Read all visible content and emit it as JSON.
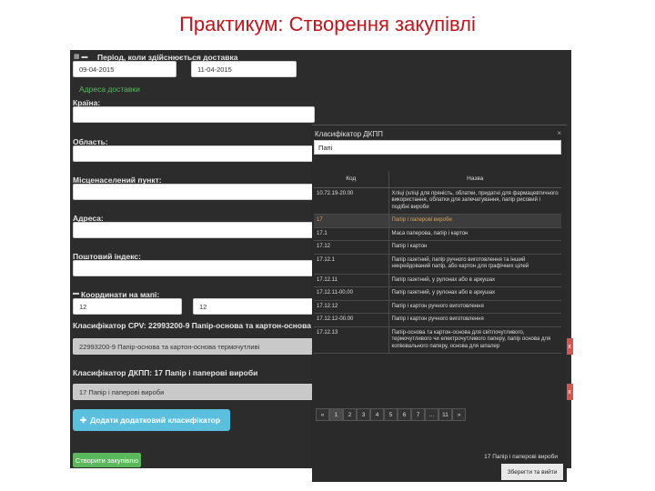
{
  "slide": {
    "title": "Практикум: Створення закупівлі"
  },
  "form": {
    "period_label": "Період, коли здійснюється доставка",
    "date_from": "09-04-2015",
    "date_to": "11-04-2015",
    "address_link": "Адреса доставки",
    "country_label": "Країна:",
    "region_label": "Область:",
    "city_label": "Місценаселений пункт:",
    "address_label": "Адреса:",
    "postcode_label": "Поштовий індекс:",
    "coords_label": "Координати на мапі:",
    "lat": "12",
    "lng": "12",
    "cpv_label": "Класифікатор CPV: 22993200-9 Папір-основа та картон-основа термочутливі",
    "cpv_value": "22993200-9 Папір-основа та картон-основа термочутливі",
    "dkpp_label": "Класифікатор ДКПП: 17 Папір і паперові вироби",
    "dkpp_value": "17 Папір і паперові вироби",
    "add_classifier": "Додати додатковий класифікатор",
    "create_button": "Створити закупівлю",
    "remove_icon": "x"
  },
  "modal": {
    "title": "Класифікатор ДКПП",
    "close": "×",
    "search": "Папі",
    "columns": [
      "Код",
      "Назва"
    ],
    "rows": [
      {
        "code": "10.72.19-20.00",
        "name": "Хліці (хліці для пряність, облатки, придатні для фармацевтичного використання, облатки для запечатування, папір рисовий і подібні вироби"
      },
      {
        "code": "17",
        "name": "Папір і паперові вироби"
      },
      {
        "code": "17.1",
        "name": "Маса паперова, папір і картон"
      },
      {
        "code": "17.12",
        "name": "Папір і картон"
      },
      {
        "code": "17.12.1",
        "name": "Папір газетний, папір ручного виготовлення та інший некрейдований папір, або картон для графічних цілей"
      },
      {
        "code": "17.12.11",
        "name": "Папір газетний, у рулонах або в аркушах"
      },
      {
        "code": "17.12.11-00.00",
        "name": "Папір газетний, у рулонах або в аркушах"
      },
      {
        "code": "17.12.12",
        "name": "Папір і картон ручного виготовлення"
      },
      {
        "code": "17.12.12-00.00",
        "name": "Папір і картон ручного виготовлення"
      },
      {
        "code": "17.12.13",
        "name": "Папір-основа та картон-основа для світлочутливого, термочутливого чи електрочутливого паперу, папір основа для копіювального паперу, основа для шпалер"
      }
    ],
    "pages": [
      "«",
      "1",
      "2",
      "3",
      "4",
      "5",
      "6",
      "7",
      "...",
      "11",
      "»"
    ],
    "selected": "17 Папір і паперові вироби",
    "save_button": "Зберегти та вийти"
  }
}
